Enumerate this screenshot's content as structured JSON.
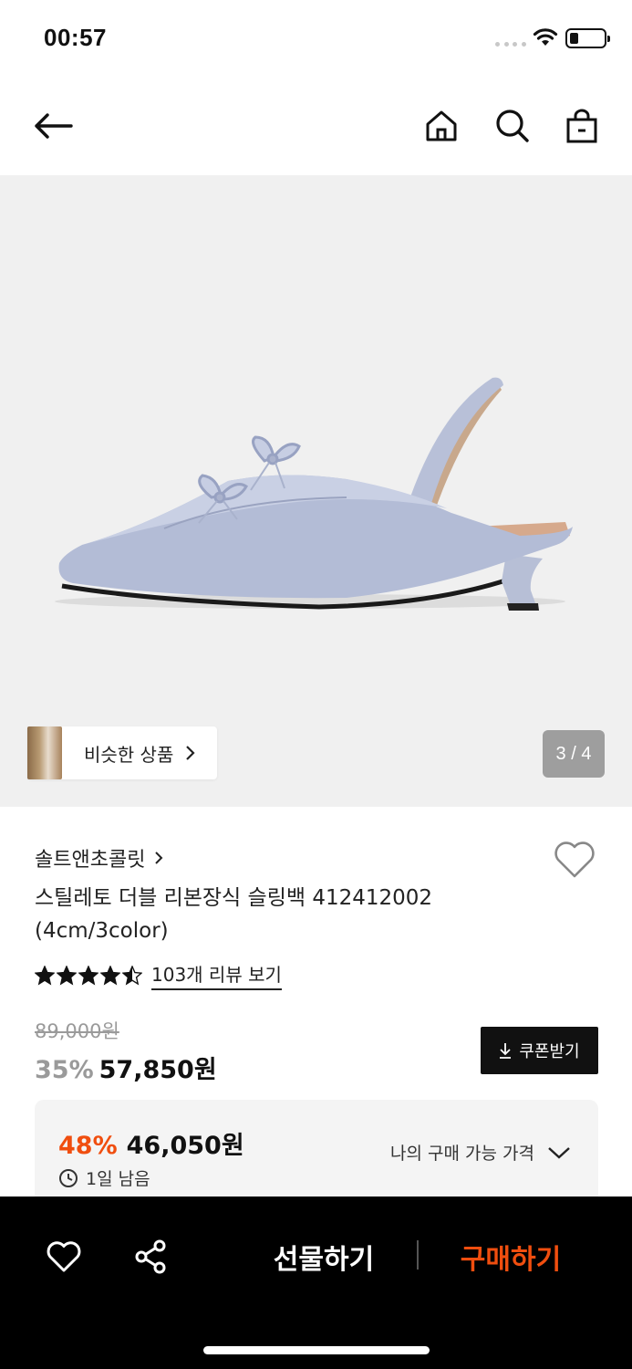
{
  "status_bar": {
    "time": "00:57"
  },
  "hero": {
    "page_counter": "3 / 4",
    "similar_label": "비슷한 상품"
  },
  "product": {
    "brand": "솔트앤초콜릿",
    "title": "스틸레토 더블 리본장식 슬링백 412412002 (4cm/3color)",
    "rating": 4.5,
    "review_link": "103개 리뷰 보기",
    "original_price": "89,000원",
    "discount_rate": "35%",
    "sale_price": "57,850원",
    "coupon_label": "쿠폰받기"
  },
  "my_price": {
    "rate": "48%",
    "price": "46,050원",
    "remaining": "1일 남음",
    "toggle_label": "나의 구매 가능 가격"
  },
  "bottom_bar": {
    "gift_label": "선물하기",
    "buy_label": "구매하기"
  },
  "colors": {
    "accent": "#f04e0f",
    "bar": "#000000"
  }
}
